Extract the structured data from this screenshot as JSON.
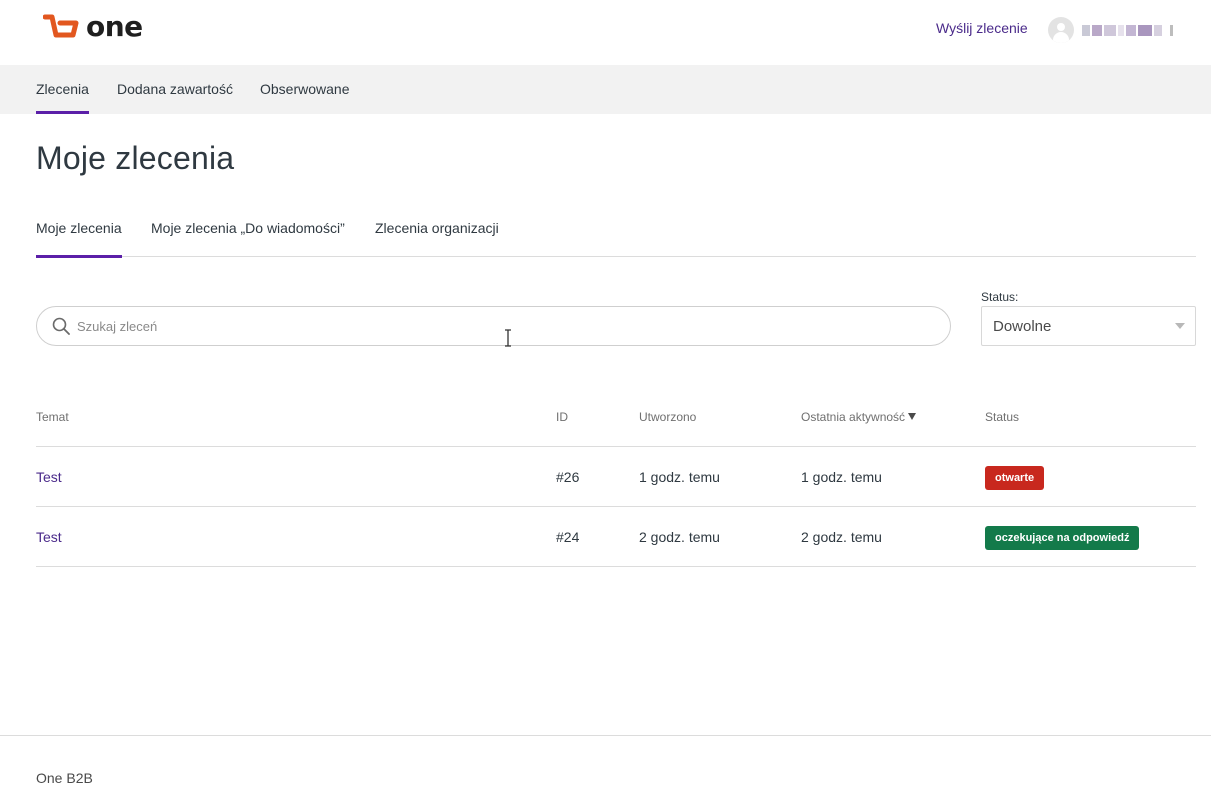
{
  "header": {
    "logo_text": "one",
    "submit_link": "Wyślij zlecenie",
    "user_name": ""
  },
  "nav": {
    "items": [
      {
        "label": "Zlecenia",
        "active": true
      },
      {
        "label": "Dodana zawartość",
        "active": false
      },
      {
        "label": "Obserwowane",
        "active": false
      }
    ]
  },
  "page": {
    "title": "Moje zlecenia"
  },
  "subtabs": [
    {
      "label": "Moje zlecenia",
      "active": true
    },
    {
      "label": "Moje zlecenia „Do wiadomości”",
      "active": false
    },
    {
      "label": "Zlecenia organizacji",
      "active": false
    }
  ],
  "filters": {
    "search_placeholder": "Szukaj zleceń",
    "search_value": "",
    "status_label": "Status:",
    "status_value": "Dowolne"
  },
  "table": {
    "columns": [
      "Temat",
      "ID",
      "Utworzono",
      "Ostatnia aktywność",
      "Status"
    ],
    "sorted_column": "Ostatnia aktywność",
    "rows": [
      {
        "subject": "Test",
        "id": "#26",
        "created": "1 godz. temu",
        "last_activity": "1 godz. temu",
        "status": "otwarte",
        "status_color": "#c8281e"
      },
      {
        "subject": "Test",
        "id": "#24",
        "created": "2 godz. temu",
        "last_activity": "2 godz. temu",
        "status": "oczekujące na odpowiedź",
        "status_color": "#137a4a"
      }
    ]
  },
  "footer": {
    "text": "One B2B"
  },
  "colors": {
    "accent": "#5b1fa8",
    "link": "#4a2a8a",
    "logo_orange": "#e2571f",
    "nav_bg": "#f2f2f2"
  }
}
